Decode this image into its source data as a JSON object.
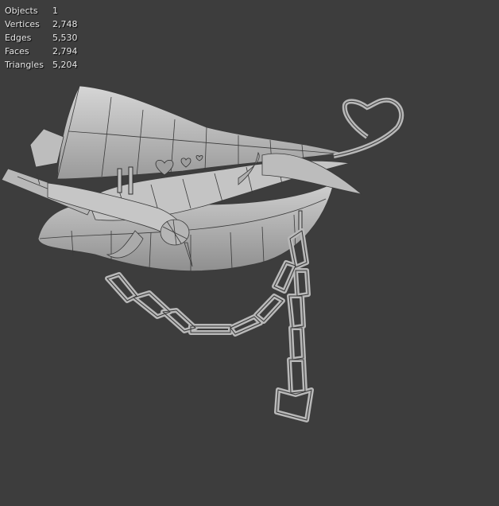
{
  "viewport": {
    "background": "#3d3d3d",
    "mesh_fill": "#c9c9c9",
    "mesh_fill_dark": "#a5a5a5",
    "wire_color": "#3a3a3a"
  },
  "stats": {
    "rows": [
      {
        "label": "Objects",
        "value": "1"
      },
      {
        "label": "Vertices",
        "value": "2,748"
      },
      {
        "label": "Edges",
        "value": "5,530"
      },
      {
        "label": "Faces",
        "value": "2,794"
      },
      {
        "label": "Triangles",
        "value": "5,204"
      }
    ]
  }
}
